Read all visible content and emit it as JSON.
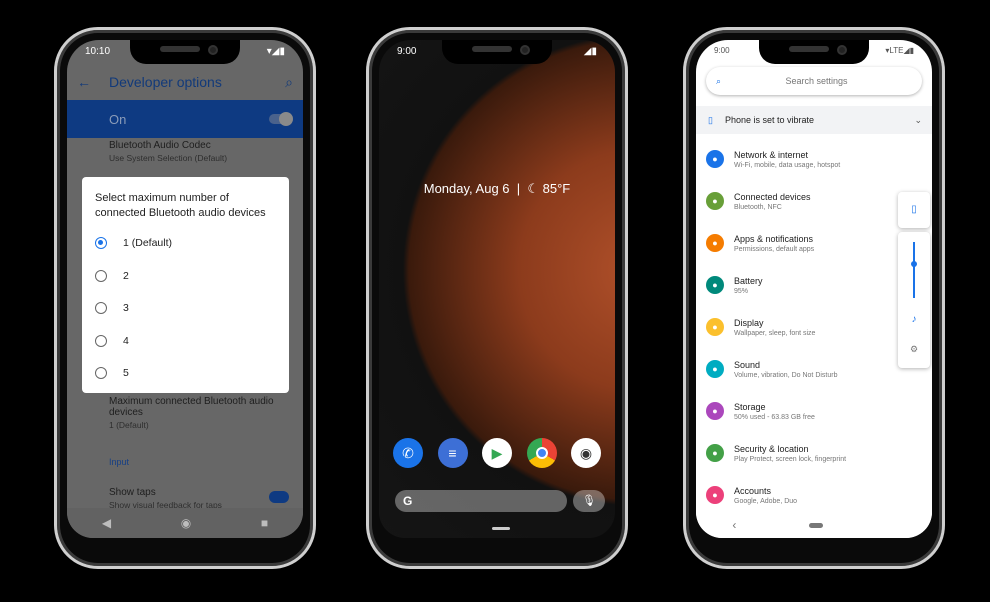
{
  "phone1": {
    "time": "10:10",
    "title": "Developer options",
    "master": "On",
    "bg_item_title": "Bluetooth Audio Codec",
    "bg_item_sub": "Use System Selection (Default)",
    "dialog": {
      "title": "Select maximum number of connected Bluetooth audio devices",
      "options": [
        "1 (Default)",
        "2",
        "3",
        "4",
        "5"
      ],
      "selected": 0
    },
    "max_item_title": "Maximum connected Bluetooth audio devices",
    "max_item_sub": "1 (Default)",
    "section": "Input",
    "taps_title": "Show taps",
    "taps_sub": "Show visual feedback for taps",
    "accent": "#1a73e8"
  },
  "phone2": {
    "time": "9:00",
    "date": "Monday, Aug 6",
    "temp": "85°F",
    "dock": [
      "phone",
      "messages",
      "play-store",
      "chrome",
      "camera"
    ]
  },
  "phone3": {
    "time": "9:00",
    "search_placeholder": "Search settings",
    "vibrate": "Phone is set to vibrate",
    "items": [
      {
        "title": "Network & internet",
        "sub": "Wi-Fi, mobile, data usage, hotspot",
        "color": "#1a73e8"
      },
      {
        "title": "Connected devices",
        "sub": "Bluetooth, NFC",
        "color": "#689f38"
      },
      {
        "title": "Apps & notifications",
        "sub": "Permissions, default apps",
        "color": "#f57c00"
      },
      {
        "title": "Battery",
        "sub": "95%",
        "color": "#00897b"
      },
      {
        "title": "Display",
        "sub": "Wallpaper, sleep, font size",
        "color": "#fbc02d"
      },
      {
        "title": "Sound",
        "sub": "Volume, vibration, Do Not Disturb",
        "color": "#00acc1"
      },
      {
        "title": "Storage",
        "sub": "50% used - 63.83 GB free",
        "color": "#ab47bc"
      },
      {
        "title": "Security & location",
        "sub": "Play Protect, screen lock, fingerprint",
        "color": "#43a047"
      },
      {
        "title": "Accounts",
        "sub": "Google, Adobe, Duo",
        "color": "#ec407a"
      }
    ],
    "volume_level": 0.6
  }
}
